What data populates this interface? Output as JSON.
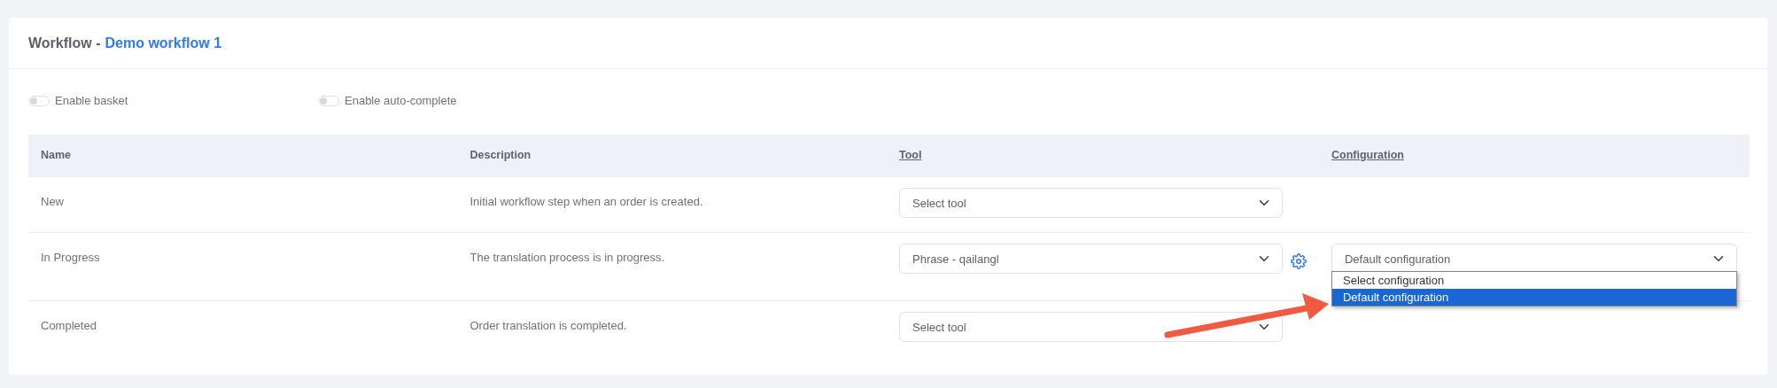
{
  "card": {
    "title": "Workflow -",
    "workflow_name": "Demo workflow 1"
  },
  "toggles": [
    {
      "label": "Enable basket",
      "on": false
    },
    {
      "label": "Enable auto-complete",
      "on": false
    }
  ],
  "table": {
    "columns": [
      {
        "label": "Name",
        "underlined": false
      },
      {
        "label": "Description",
        "underlined": false
      },
      {
        "label": "Tool",
        "underlined": true
      },
      {
        "label": "Configuration",
        "underlined": true
      }
    ],
    "rows": [
      {
        "name": "New",
        "description": "Initial workflow step when an order is created.",
        "tool": "Select tool",
        "settings": false
      },
      {
        "name": "In Progress",
        "description": "The translation process is in progress.",
        "tool": "Phrase - qailangl",
        "settings": true,
        "configuration": {
          "value": "Default configuration",
          "expanded": true,
          "options": [
            {
              "label": "Select configuration",
              "selected": false
            },
            {
              "label": "Default configuration",
              "selected": true
            }
          ]
        }
      },
      {
        "name": "Completed",
        "description": "Order translation is completed.",
        "tool": "Select tool",
        "settings": false
      }
    ]
  }
}
